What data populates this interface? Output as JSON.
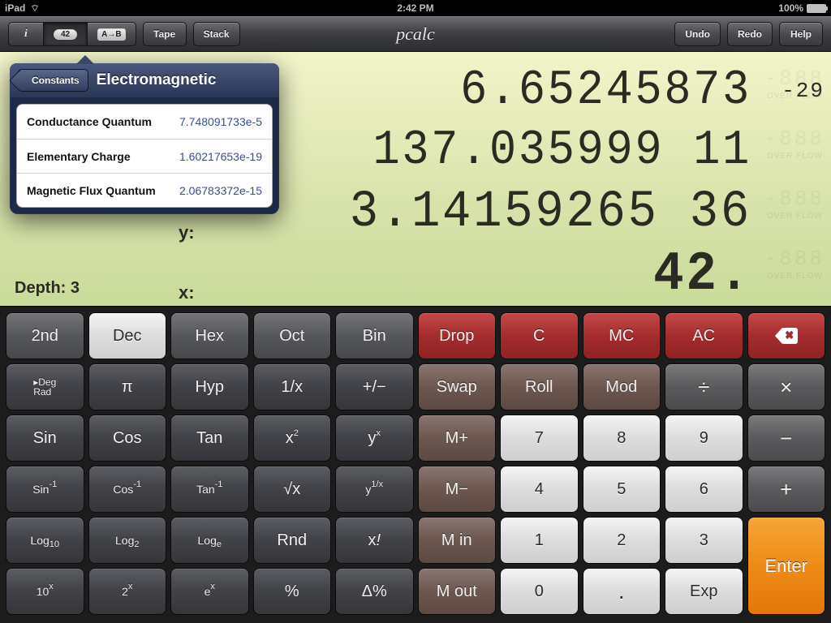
{
  "statusbar": {
    "carrier": "iPad",
    "time": "2:42 PM",
    "battery_pct": "100%"
  },
  "toolbar": {
    "info_icon": "i",
    "constants_btn": "42",
    "convert_btn": "A→B",
    "tape": "Tape",
    "stack": "Stack",
    "title": "pcalc",
    "undo": "Undo",
    "redo": "Redo",
    "help": "Help"
  },
  "popover": {
    "back": "Constants",
    "title": "Electromagnetic",
    "rows": [
      {
        "name": "Conductance Quantum",
        "value": "7.748091733e-5"
      },
      {
        "name": "Elementary Charge",
        "value": "1.60217653e-19"
      },
      {
        "name": "Magnetic Flux Quantum",
        "value": "2.06783372e-15"
      }
    ]
  },
  "lcd": {
    "depth_label": "Depth: 3",
    "y_label": "y:",
    "x_label": "x:",
    "rows": [
      {
        "value": "6.65245873",
        "exp": "-29"
      },
      {
        "value": "137.035999 11",
        "exp": ""
      },
      {
        "value": "3.14159265 36",
        "exp": ""
      },
      {
        "value": "42.",
        "exp": ""
      }
    ],
    "overflow_flag": "OVER\nFLOW"
  },
  "keys": {
    "r1": [
      "2nd",
      "Dec",
      "Hex",
      "Oct",
      "Bin",
      "Drop",
      "C",
      "MC",
      "AC",
      ""
    ],
    "r2_degrad_top": "▸Deg",
    "r2_degrad_bot": "Rad",
    "r2": [
      "π",
      "Hyp",
      "1/x",
      "+/−",
      "Swap",
      "Roll",
      "Mod",
      "÷",
      "×"
    ],
    "r3": [
      "Sin",
      "Cos",
      "Tan",
      "x²",
      "yˣ",
      "M+",
      "7",
      "8",
      "9",
      "−"
    ],
    "r4": [
      "Sin⁻¹",
      "Cos⁻¹",
      "Tan⁻¹",
      "√x",
      "y^1/x",
      "M−",
      "4",
      "5",
      "6",
      "+"
    ],
    "r5": [
      "Log₁₀",
      "Log₂",
      "Logₑ",
      "Rnd",
      "x!",
      "M in",
      "1",
      "2",
      "3"
    ],
    "r6": [
      "10ˣ",
      "2ˣ",
      "eˣ",
      "%",
      "Δ%",
      "M out",
      "0",
      ".",
      "Exp"
    ],
    "enter": "Enter"
  }
}
